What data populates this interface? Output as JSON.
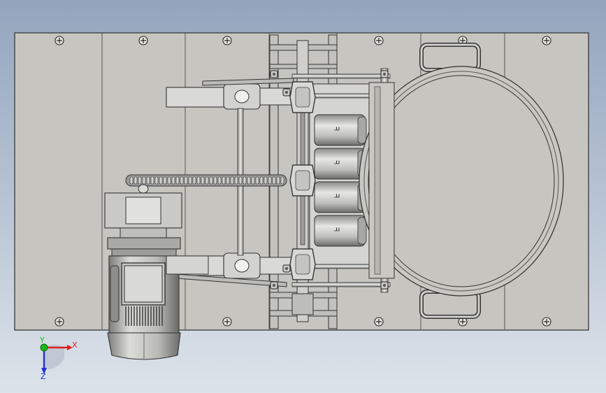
{
  "viewport": {
    "background_top": "#93a5bd",
    "background_bottom": "#dde3ea"
  },
  "model": {
    "plate_color": "#c6c5bf",
    "edge_color": "#2e2e2e",
    "metal_color": "#cfd0cc",
    "dark_metal": "#6e6f6c",
    "motor_label_marks": "ᖷ"
  },
  "triad": {
    "x_label": "X",
    "y_label": "Y",
    "z_label": "Z",
    "x_color": "#e02020",
    "y_color": "#18b818",
    "z_color": "#2030d8"
  }
}
